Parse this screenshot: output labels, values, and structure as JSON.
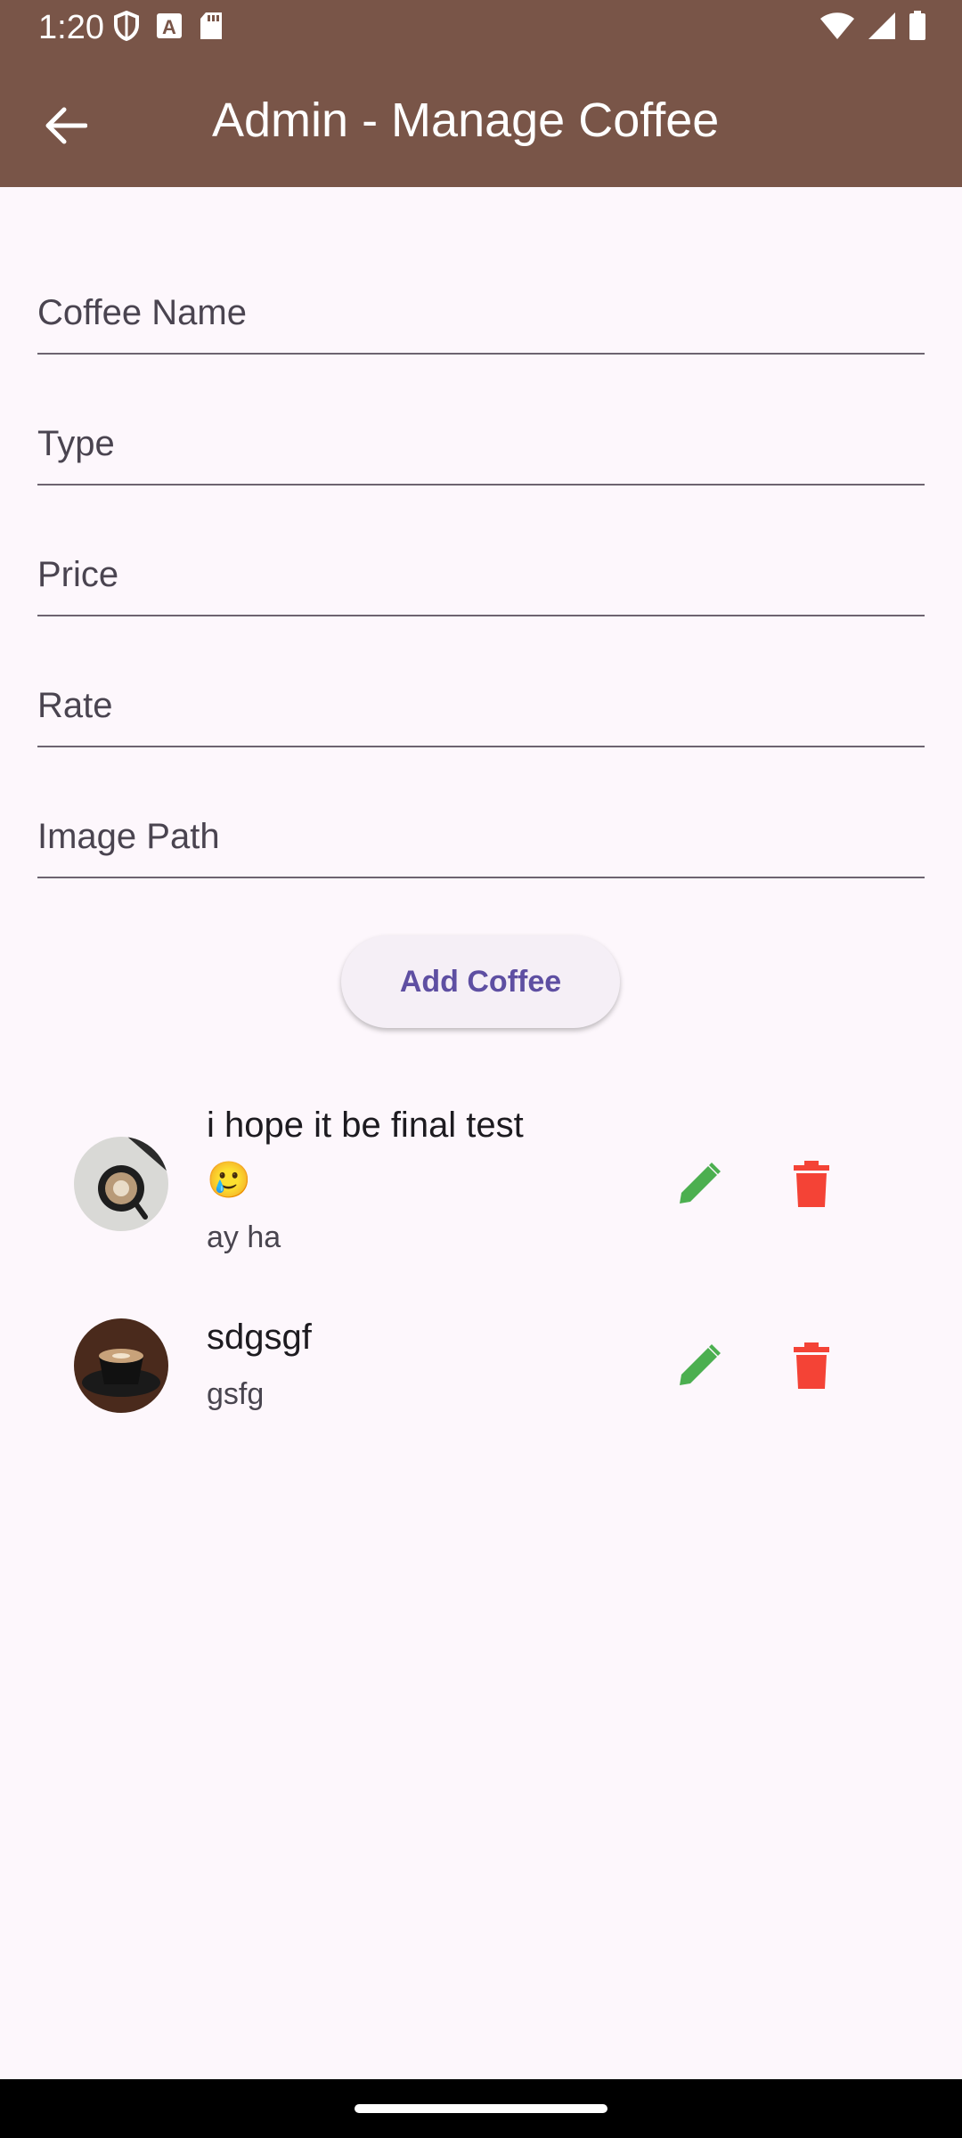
{
  "status_bar": {
    "time": "1:20"
  },
  "app_bar": {
    "title": "Admin - Manage Coffee",
    "back_icon": "arrow-back-icon",
    "background": "#795548"
  },
  "form": {
    "fields": [
      {
        "placeholder": "Coffee Name",
        "value": ""
      },
      {
        "placeholder": "Type",
        "value": ""
      },
      {
        "placeholder": "Price",
        "value": ""
      },
      {
        "placeholder": "Rate",
        "value": ""
      },
      {
        "placeholder": "Image Path",
        "value": ""
      }
    ],
    "add_button_label": "Add Coffee"
  },
  "coffees": [
    {
      "name_line1": "i hope it be final test",
      "name_line2": "🥲",
      "type": "ay ha",
      "avatar_icon": "coffee-cup-topview-image"
    },
    {
      "name_line1": "sdgsgf",
      "type": "gsfg",
      "avatar_icon": "espresso-cup-image"
    }
  ],
  "colors": {
    "accent": "#5e4fa2",
    "edit": "#4caf50",
    "delete": "#f44336"
  }
}
